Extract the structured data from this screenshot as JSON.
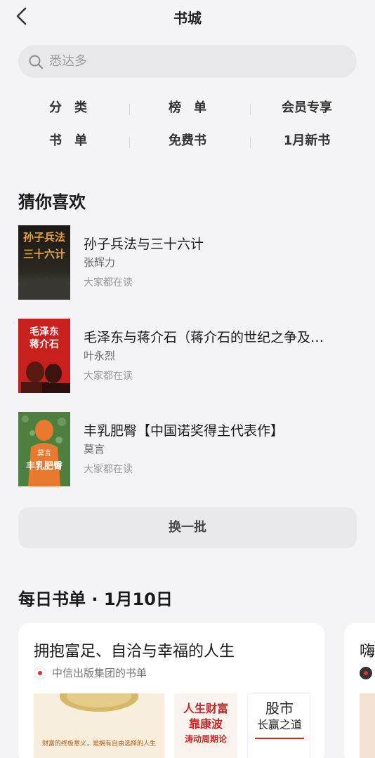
{
  "header": {
    "title": "书城",
    "back_icon": "chevron-left-icon"
  },
  "search": {
    "placeholder": "悉达多",
    "icon": "search-icon"
  },
  "entries": {
    "row1": [
      "分　类",
      "榜　单",
      "会员专享"
    ],
    "row2": [
      "书　单",
      "免费书",
      "1月新书"
    ]
  },
  "recommend": {
    "title": "猜你喜欢",
    "books": [
      {
        "title": "孙子兵法与三十六计",
        "author": "张辉力",
        "status": "大家都在读",
        "cover_text": [
          "孙子兵法",
          "三十六计"
        ]
      },
      {
        "title": "毛泽东与蒋介石（蒋介石的世纪之争及…",
        "author": "叶永烈",
        "status": "大家都在读",
        "cover_text": [
          "毛泽东",
          "蒋介石"
        ]
      },
      {
        "title": "丰乳肥臀【中国诺奖得主代表作】",
        "author": "莫言",
        "status": "大家都在读",
        "cover_text": [
          "莫言",
          "丰乳肥臀"
        ]
      }
    ],
    "refresh_label": "换一批"
  },
  "daily": {
    "title": "每日书单 · 1月10日",
    "cards": [
      {
        "title": "拥抱富足、自洽与幸福的人生",
        "source": "中信出版集团的书单",
        "thumbs": [
          {
            "lines": [
              "财富的终极意义，是拥有自由选择的人生"
            ]
          },
          {
            "lines": [
              "人生财富",
              "靠康波",
              "涛动周期论"
            ]
          },
          {
            "lines": [
              "股市",
              "长赢之道"
            ]
          }
        ]
      },
      {
        "title": "嗨",
        "source": ""
      }
    ]
  },
  "colors": {
    "background": "#f4f4f6",
    "card": "#ffffff",
    "accent_red": "#d9362b"
  }
}
